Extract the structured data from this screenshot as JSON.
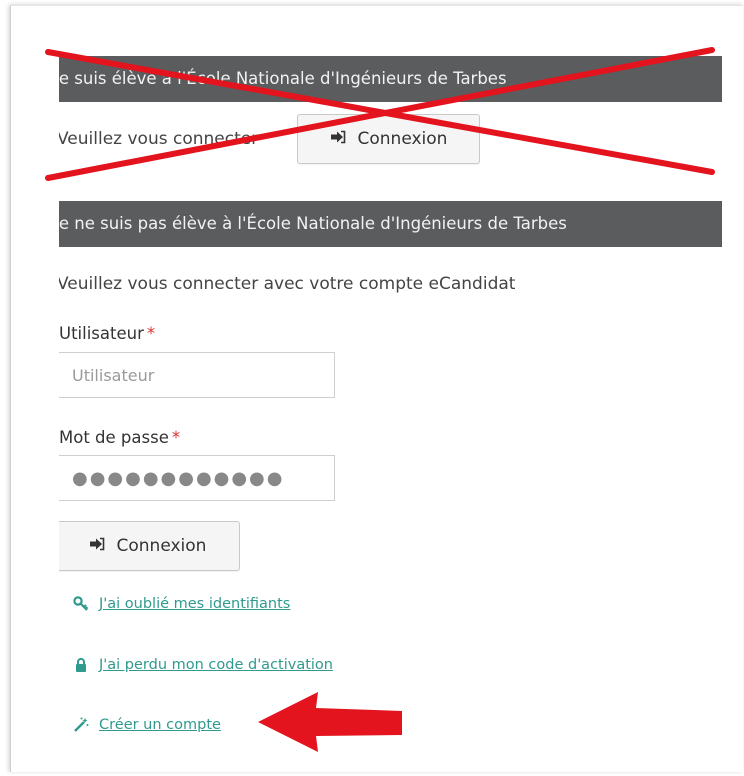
{
  "section_internal": {
    "header": "Je suis élève à l'École Nationale d'Ingénieurs de Tarbes",
    "prompt": "Veuillez vous connecter",
    "login_button": "Connexion"
  },
  "section_external": {
    "header": "Je ne suis pas élève à l'École Nationale d'Ingénieurs de Tarbes",
    "prompt": "Veuillez vous connecter avec votre compte eCandidat",
    "username": {
      "label": "Utilisateur",
      "required_mark": "*",
      "placeholder": "Utilisateur",
      "value": ""
    },
    "password": {
      "label": "Mot de passe",
      "required_mark": "*",
      "value": "●●●●●●●●●●●●"
    },
    "login_button": "Connexion",
    "links": {
      "forgot_credentials": "J'ai oublié mes identifiants",
      "lost_activation_code": "J'ai perdu mon code d'activation",
      "create_account": "Créer un compte"
    }
  },
  "colors": {
    "header_bg": "#5b5c5e",
    "link": "#2f9a8d",
    "annotation_red": "#e3141d"
  },
  "icons": [
    "sign-in-icon",
    "key-icon",
    "lock-icon",
    "magic-wand-icon"
  ],
  "annotations": {
    "cross_out": "red-x-over-internal-section",
    "arrow": "red-arrow-pointing-to-create-account"
  }
}
